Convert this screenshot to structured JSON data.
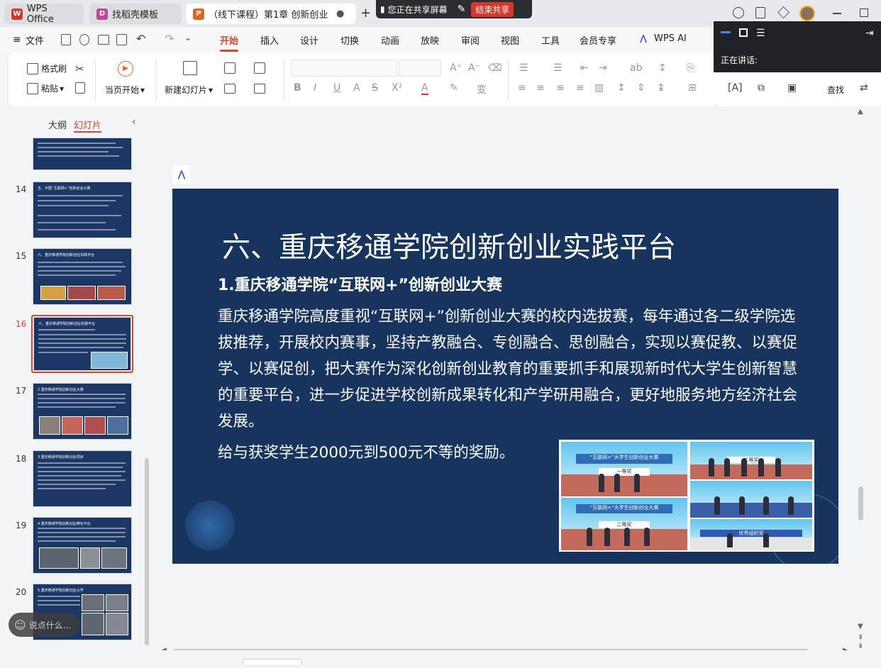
{
  "tabs": [
    {
      "label": "WPS Office",
      "icon": "wps-logo-icon"
    },
    {
      "label": "找稻壳模板",
      "icon": "docer-icon"
    },
    {
      "label": "（线下课程）第1章 创新创业",
      "icon": "presentation-file-icon"
    }
  ],
  "share": {
    "status": "您正在共享屏幕",
    "end_label": "结束共享"
  },
  "menu": {
    "file": "文件",
    "tabs": [
      "开始",
      "插入",
      "设计",
      "切换",
      "动画",
      "放映",
      "审阅",
      "视图",
      "工具",
      "会员专享",
      "WPS AI"
    ],
    "active": "开始"
  },
  "ribbon": {
    "format_painter": "格式刷",
    "paste": "粘贴",
    "play_from_current": "当页开始",
    "new_slide": "新建幻灯片",
    "find": "查找"
  },
  "speaking": {
    "label": "正在讲话:"
  },
  "sidebar": {
    "outline_tab": "大纲",
    "slides_tab": "幻灯片",
    "active_tab": "幻灯片",
    "thumbnails": [
      {
        "number": "",
        "title": ""
      },
      {
        "number": "14",
        "title": "五、中国“互联网+”创新创业大赛"
      },
      {
        "number": "15",
        "title": "六、重庆移通学院创新创业实践平台"
      },
      {
        "number": "16",
        "title": "六、重庆移通学院创新创业实践平台",
        "selected": true
      },
      {
        "number": "17",
        "title": "2.重庆移通学院创新创业大赛"
      },
      {
        "number": "18",
        "title": "3.重庆移通学院创新创业项目"
      },
      {
        "number": "19",
        "title": "4.重庆移通学院创新创业孵化平台"
      },
      {
        "number": "20",
        "title": "5.重庆移通学院创新创业大学"
      }
    ]
  },
  "slide": {
    "title": "六、重庆移通学院创新创业实践平台",
    "subtitle": "1.重庆移通学院“互联网+”创新创业大赛",
    "body": "重庆移通学院高度重视“互联网+”创新创业大赛的校内选拔赛，每年通过各二级学院选拔推荐，开展校内赛事，坚持产教融合、专创融合、思创融合，实现以赛促教、以赛促学、以赛促创，把大赛作为深化创新创业教育的重要抓手和展现新时代大学生创新智慧的重要平台，进一步促进学校创新成果转化和产学研用融合，更好地服务地方经济社会发展。",
    "award_text": "给与获奖学生2000元到500元不等的奖励。",
    "photo_banners": [
      "“互联网+”大学生创新创业大赛",
      "一等奖",
      "二等奖",
      "“互联网+”大学生创新创业大赛",
      "二等奖",
      "优秀组织奖"
    ],
    "accent_color": "#17345f"
  },
  "chat_placeholder": "说点什么...",
  "colors": {
    "brand": "#d9462b",
    "slide_bg": "#17345f",
    "share_end": "#d9362b"
  }
}
